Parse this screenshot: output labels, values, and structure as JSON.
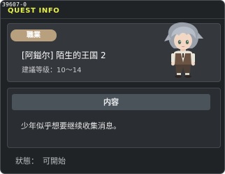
{
  "quest": {
    "id": "39607-0",
    "window_title": "QUEST INFO",
    "job_label": "職業",
    "name": "[阿鎰尔] 陌生的王国 2",
    "recommended_level_label": "建議等级：",
    "recommended_level": "10～14",
    "npc_portrait": "npc-silver-haired-boy"
  },
  "content": {
    "header": "内容",
    "body": "少年似乎想要继续收集消息。"
  },
  "status": {
    "label": "狀態：",
    "value": "可開始"
  },
  "colors": {
    "title_accent": "#e6f04a",
    "job_badge": "#b89f7e",
    "panel": "#34373c",
    "header_bar": "#4a525a"
  }
}
